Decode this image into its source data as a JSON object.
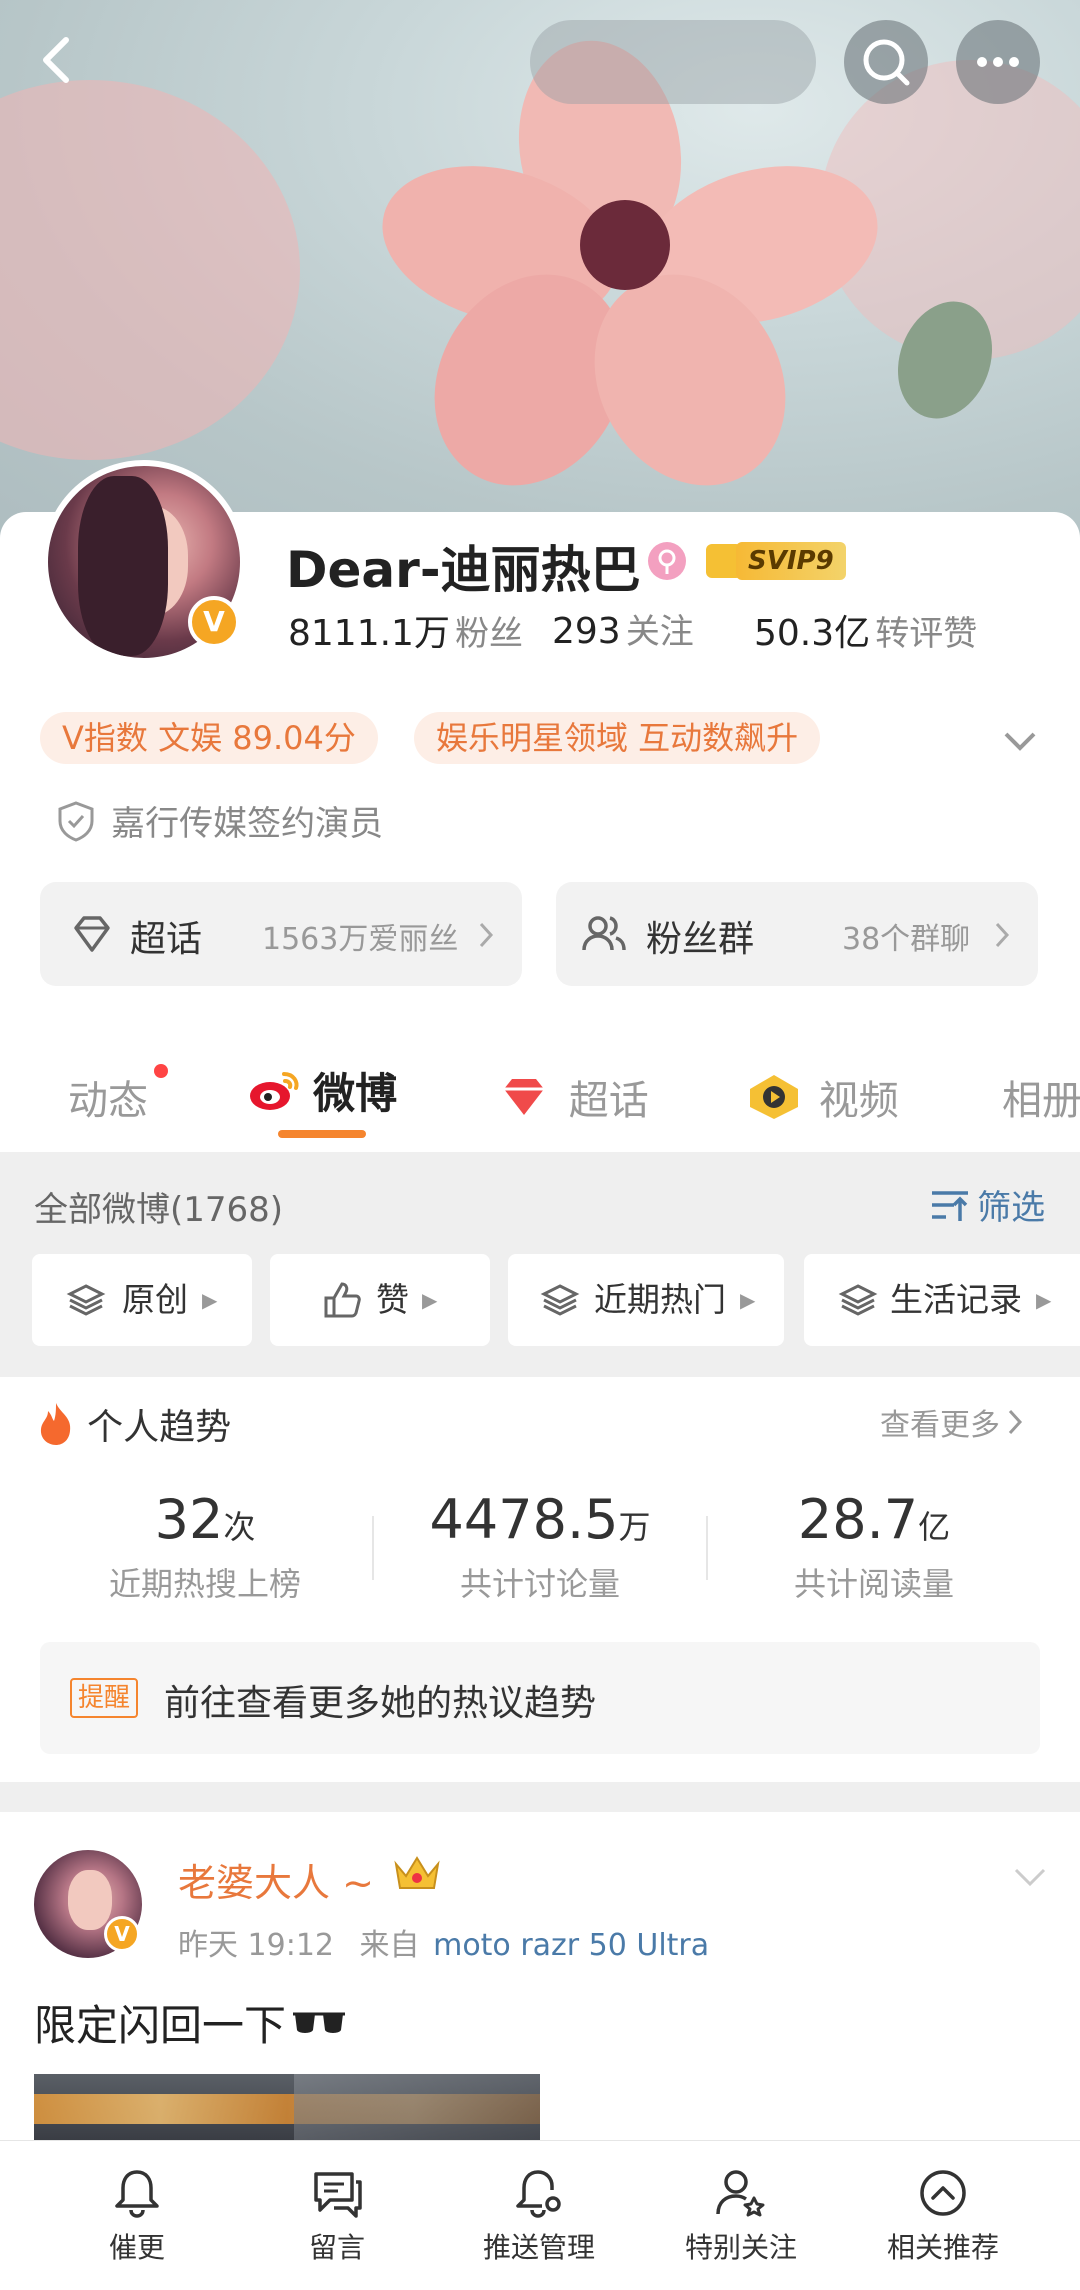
{
  "profile": {
    "name": "Dear-迪丽热巴",
    "vip_badge": "SVIP9",
    "stats": [
      {
        "value": "8111.1万",
        "label": "粉丝"
      },
      {
        "value": "293",
        "label": "关注"
      },
      {
        "value": "50.3亿",
        "label": "转评赞"
      }
    ],
    "tags": [
      "V指数 文娱 89.04分",
      "娱乐明星领域 互动数飙升"
    ],
    "verification": "嘉行传媒签约演员"
  },
  "quick_links": [
    {
      "label": "超话",
      "detail": "1563万爱丽丝"
    },
    {
      "label": "粉丝群",
      "detail": "38个群聊"
    }
  ],
  "tabs": [
    {
      "label": "动态"
    },
    {
      "label": "微博"
    },
    {
      "label": "超话"
    },
    {
      "label": "视频"
    },
    {
      "label": "相册"
    }
  ],
  "feed": {
    "title": "全部微博(1768)",
    "filter_label": "筛选",
    "chips": [
      "原创",
      "赞",
      "近期热门",
      "生活记录"
    ]
  },
  "trend": {
    "title": "个人趋势",
    "more": "查看更多",
    "items": [
      {
        "value": "32",
        "unit": "次",
        "label": "近期热搜上榜"
      },
      {
        "value": "4478.5",
        "unit": "万",
        "label": "共计讨论量"
      },
      {
        "value": "28.7",
        "unit": "亿",
        "label": "共计阅读量"
      }
    ],
    "reminder_tag": "提醒",
    "reminder_text": "前往查看更多她的热议趋势"
  },
  "post": {
    "author": "老婆大人 ~",
    "time": "昨天 19:12",
    "source_prefix": "来自",
    "source": "moto razr 50 Ultra",
    "text": "限定闪回一下"
  },
  "bottom_bar": [
    {
      "label": "催更",
      "icon": "bell-icon"
    },
    {
      "label": "留言",
      "icon": "message-icon"
    },
    {
      "label": "推送管理",
      "icon": "bell-settings-icon"
    },
    {
      "label": "特别关注",
      "icon": "user-star-icon"
    },
    {
      "label": "相关推荐",
      "icon": "arrow-up-circle-icon"
    }
  ],
  "colors": {
    "accent": "#f5852e",
    "link": "#4a7aa8",
    "orange_text": "#e8783c"
  }
}
